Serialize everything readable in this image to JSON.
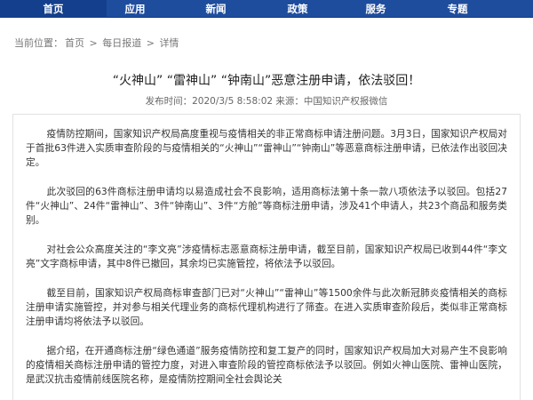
{
  "nav": {
    "items": [
      {
        "label": "首页"
      },
      {
        "label": "应用"
      },
      {
        "label": "新闻"
      },
      {
        "label": "政策"
      },
      {
        "label": "服务"
      },
      {
        "label": "专题"
      }
    ]
  },
  "breadcrumb": {
    "prefix": "当前位置：",
    "items": [
      "首页",
      "每日报道",
      "详情"
    ],
    "separator": " > "
  },
  "article": {
    "title": "“火神山” “雷神山” “钟南山”恶意注册申请，依法驳回！",
    "meta": "发布时间：2020/3/5 8:58:02  来源：中国知识产权报微信",
    "paragraphs": [
      "疫情防控期间，国家知识产权局高度重视与疫情相关的非正常商标申请注册问题。3月3日，国家知识产权局对于首批63件进入实质审查阶段的与疫情相关的“火神山”“雷神山”“钟南山”等恶意商标注册申请，已依法作出驳回决定。",
      "此次驳回的63件商标注册申请均以易造成社会不良影响，适用商标法第十条一款八项依法予以驳回。包括27件“火神山”、24件“雷神山”、3件“钟南山”、3件“方舱”等商标注册申请，涉及41个申请人，共23个商品和服务类别。",
      "对社会公众高度关注的“李文亮”涉疫情标志恶意商标注册申请，截至目前，国家知识产权局已收到44件“李文亮”文字商标申请，其中8件已撤回，其余均已实施管控，将依法予以驳回。",
      "截至目前，国家知识产权局商标审查部门已对“火神山”“雷神山”等1500余件与此次新冠肺炎疫情相关的商标注册申请实施管控，并对参与相关代理业务的商标代理机构进行了筛查。在进入实质审查阶段后，类似非正常商标注册申请均将依法予以驳回。",
      "据介绍，在开通商标注册“绿色通道”服务疫情防控和复工复产的同时，国家知识产权局加大对易产生不良影响的疫情相关商标注册申请的管控力度，对进入审查阶段的管控商标依法予以驳回。例如火神山医院、雷神山医院，是武汉抗击疫情前线医院名称，是疫情防控期间全社会舆论关"
    ]
  },
  "colors": {
    "nav_bg": "#1f4d9e",
    "nav_active_bg": "#143f8c",
    "nav_text": "#ffffff"
  }
}
